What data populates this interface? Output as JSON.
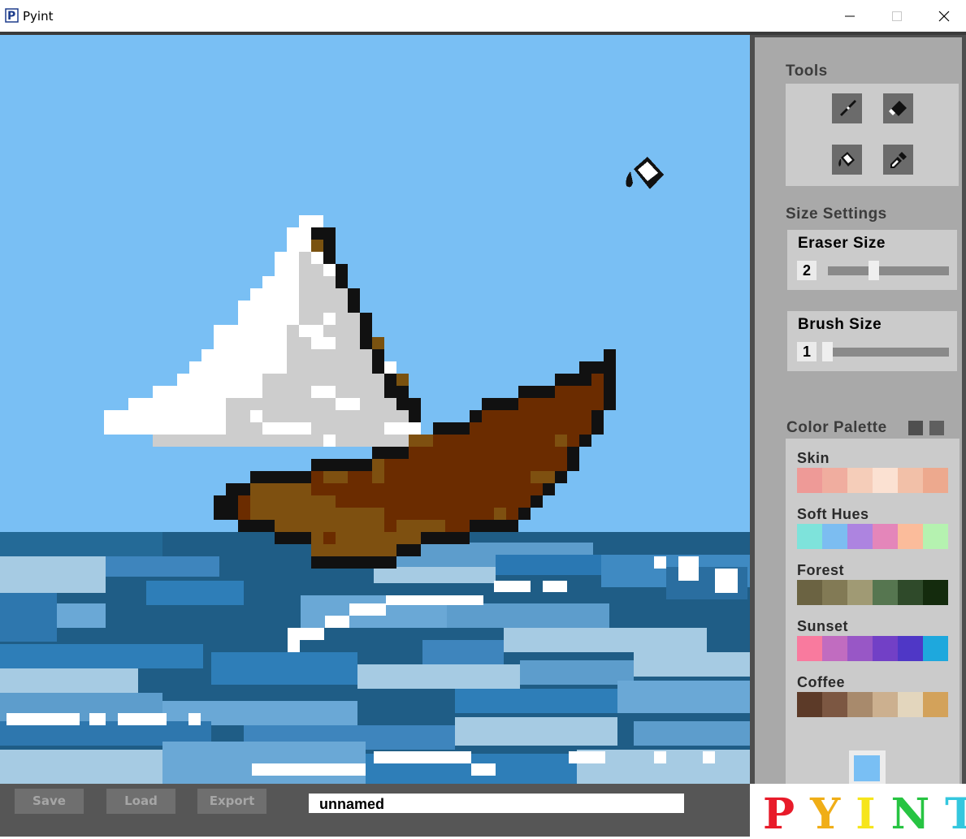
{
  "window": {
    "title": "Pyint"
  },
  "canvas": {
    "background": "#79bff4"
  },
  "sidebar": {
    "tools_title": "Tools",
    "tools": [
      {
        "name": "brush-icon"
      },
      {
        "name": "eraser-icon"
      },
      {
        "name": "fill-bucket-icon"
      },
      {
        "name": "eyedropper-icon"
      }
    ],
    "size_settings_title": "Size Settings",
    "eraser": {
      "label": "Eraser Size",
      "value": "2"
    },
    "brush": {
      "label": "Brush Size",
      "value": "1"
    },
    "palette_title": "Color Palette",
    "palettes": [
      {
        "label": "Skin",
        "colors": [
          "#ee9a97",
          "#f0ad9f",
          "#f5cdb9",
          "#fbe1d2",
          "#f2c0a8",
          "#eda98e"
        ]
      },
      {
        "label": "Soft Hues",
        "colors": [
          "#7ee3db",
          "#7cbdf1",
          "#ad84e0",
          "#e486ba",
          "#fbbc9b",
          "#b5f2b0"
        ]
      },
      {
        "label": "Forest",
        "colors": [
          "#6b6342",
          "#827a55",
          "#a09a74",
          "#567650",
          "#2f4a2a",
          "#142b0d"
        ]
      },
      {
        "label": "Sunset",
        "colors": [
          "#f97a9e",
          "#c16cc0",
          "#9857c6",
          "#7240c6",
          "#4f37c6",
          "#1ea8dd"
        ]
      },
      {
        "label": "Coffee",
        "colors": [
          "#5c3a28",
          "#7c5742",
          "#a88a6c",
          "#ccb08f",
          "#e3d6bd",
          "#d3a25a"
        ]
      }
    ],
    "current_color": "#79bff4"
  },
  "bottom": {
    "save": "Save",
    "load": "Load",
    "export": "Export",
    "filename": "unnamed"
  },
  "logo": {
    "letters": [
      "P",
      "Y",
      "I",
      "N",
      "T"
    ],
    "colors": [
      "#e81b2a",
      "#f0ae17",
      "#f6e51b",
      "#27c442",
      "#34c7de"
    ]
  }
}
